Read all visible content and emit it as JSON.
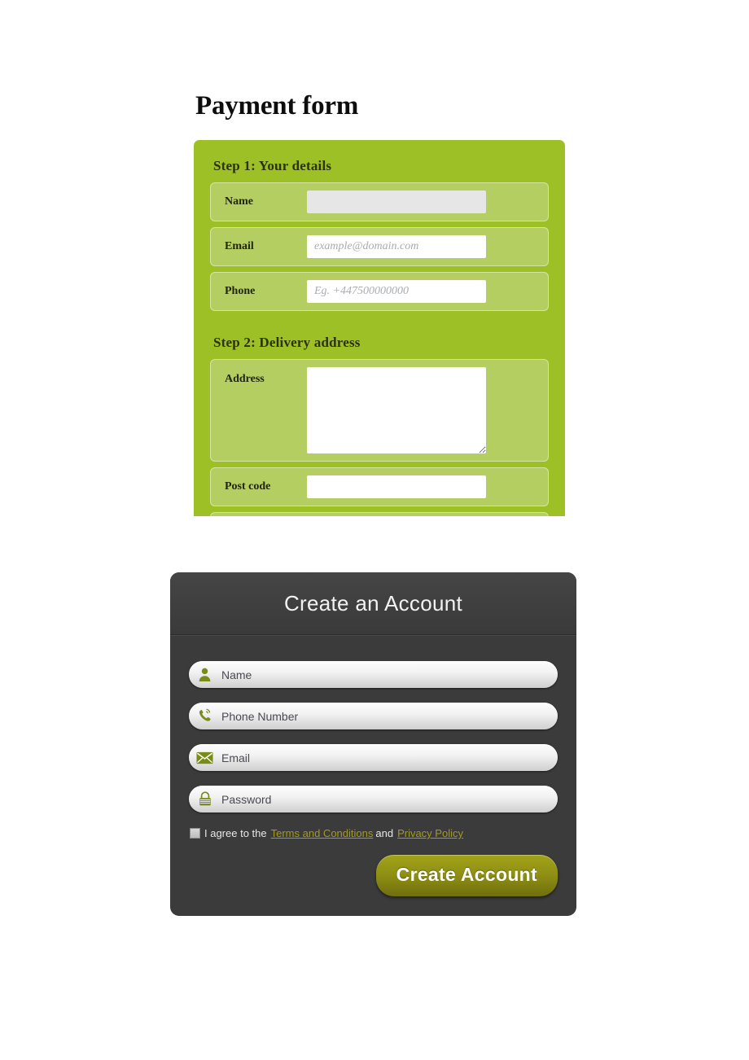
{
  "payment_form": {
    "title": "Payment form",
    "steps": [
      {
        "heading": "Step 1: Your details",
        "fields": [
          {
            "label": "Name",
            "value": "",
            "placeholder": "",
            "type": "text",
            "style": "grey"
          },
          {
            "label": "Email",
            "value": "",
            "placeholder": "example@domain.com",
            "type": "text",
            "style": "white"
          },
          {
            "label": "Phone",
            "value": "",
            "placeholder": "Eg. +447500000000",
            "type": "text",
            "style": "white"
          }
        ]
      },
      {
        "heading": "Step 2: Delivery address",
        "fields": [
          {
            "label": "Address",
            "value": "",
            "placeholder": "",
            "type": "textarea",
            "style": "white"
          },
          {
            "label": "Post code",
            "value": "",
            "placeholder": "",
            "type": "text",
            "style": "white"
          }
        ]
      }
    ],
    "colors": {
      "panel": "#9dc026",
      "row": "#b5ce62",
      "row_border": "#d6e4a2",
      "label": "#21260a"
    }
  },
  "account_form": {
    "title": "Create an Account",
    "fields": [
      {
        "icon": "user-icon",
        "placeholder": "Name",
        "value": "",
        "type": "text"
      },
      {
        "icon": "phone-icon",
        "placeholder": "Phone Number",
        "value": "",
        "type": "tel"
      },
      {
        "icon": "envelope-icon",
        "placeholder": "Email",
        "value": "",
        "type": "email"
      },
      {
        "icon": "lock-icon",
        "placeholder": "Password",
        "value": "",
        "type": "password"
      }
    ],
    "agreement": {
      "checked": false,
      "prefix": "I agree to the",
      "terms_link": "Terms and Conditions",
      "conjunction": "and",
      "privacy_link": "Privacy Policy"
    },
    "submit_label": "Create Account",
    "colors": {
      "card": "#3b3b3b",
      "header": "#454545",
      "icon": "#7a8c18",
      "link": "#a39b20",
      "button": "#8e8e14"
    }
  }
}
